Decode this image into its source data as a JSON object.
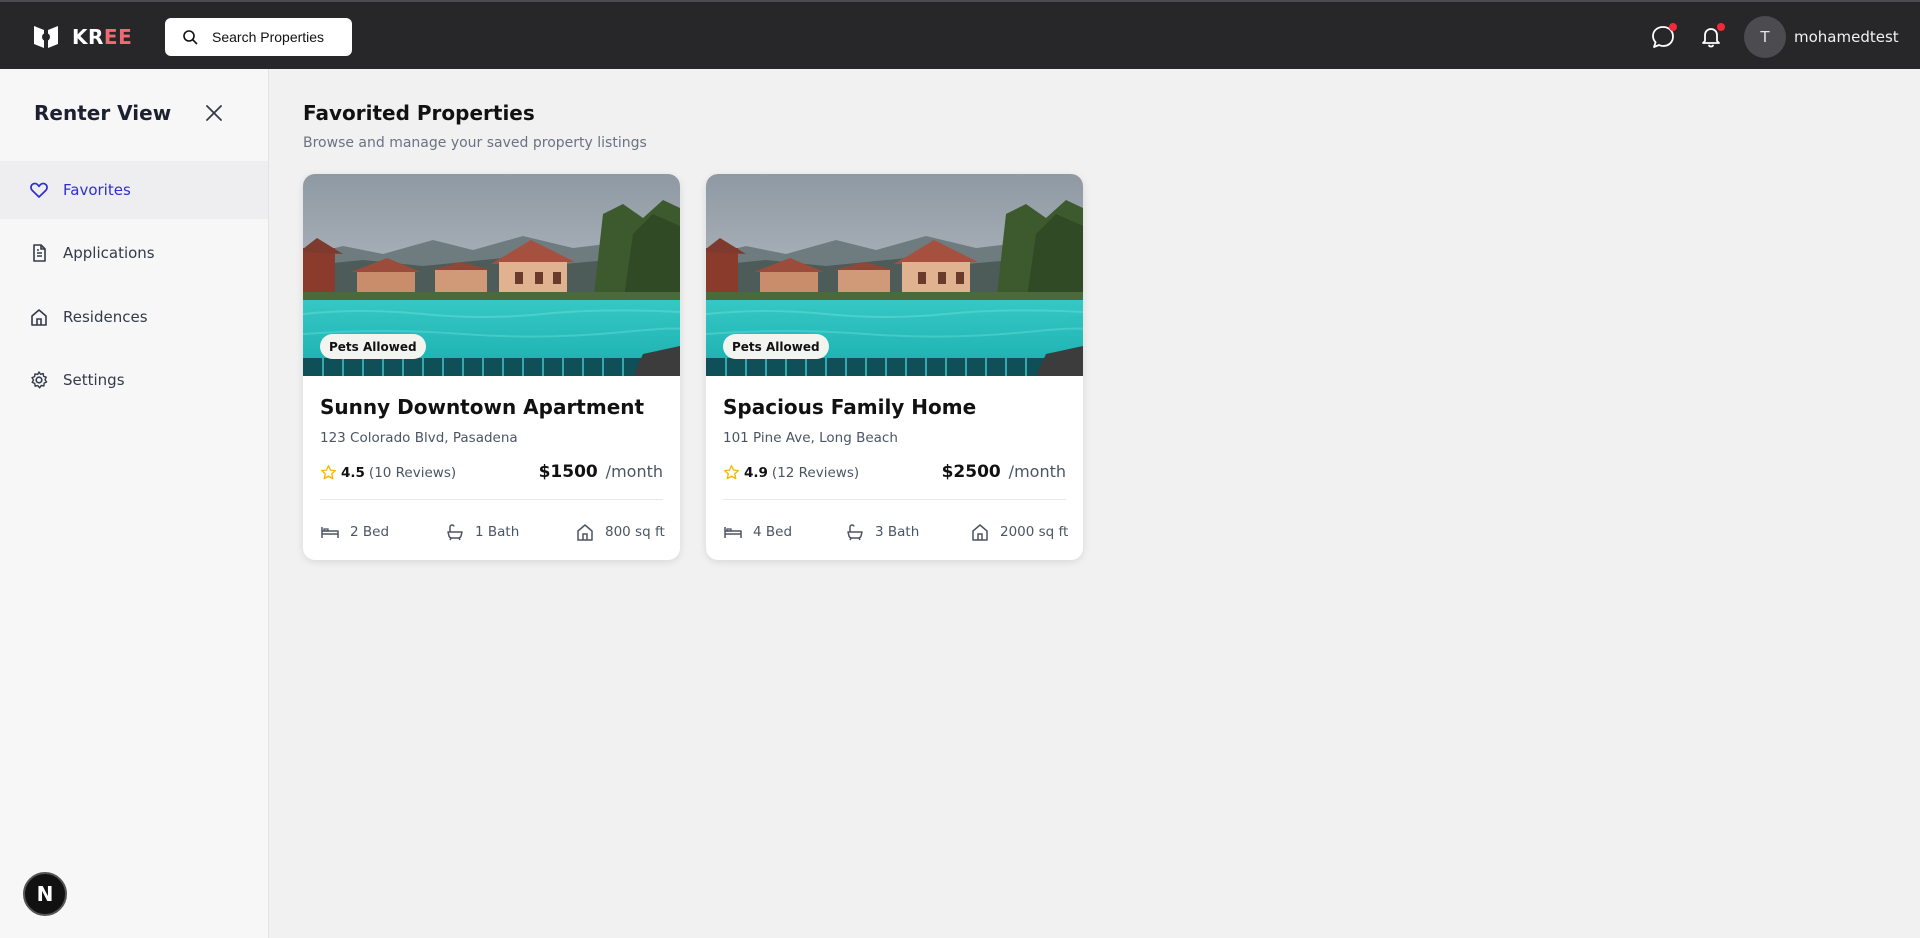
{
  "app": {
    "brand_primary": "KR",
    "brand_accent": "EE",
    "search_label": "Search Properties",
    "username": "mohamedtest",
    "avatar_initial": "T",
    "colors": {
      "topbar": "#27272a",
      "accent": "#ef6b73",
      "active_nav": "#2d2fd0",
      "notification_dot": "#ef2b3a",
      "star": "#f5b800"
    }
  },
  "header_icons": [
    "chat-icon",
    "bell-icon"
  ],
  "sidebar": {
    "title": "Renter View",
    "items": [
      {
        "label": "Favorites",
        "icon": "heart-icon",
        "active": true
      },
      {
        "label": "Applications",
        "icon": "document-icon",
        "active": false
      },
      {
        "label": "Residences",
        "icon": "house-icon",
        "active": false
      },
      {
        "label": "Settings",
        "icon": "gear-icon",
        "active": false
      }
    ],
    "badge": "N"
  },
  "main": {
    "title": "Favorited Properties",
    "subtitle": "Browse and manage your saved property listings"
  },
  "properties": [
    {
      "badge": "Pets Allowed",
      "name": "Sunny Downtown Apartment",
      "address": "123 Colorado Blvd, Pasadena",
      "rating": "4.5",
      "reviews": "(10 Reviews)",
      "price": "$1500",
      "price_unit": "/month",
      "beds": "2 Bed",
      "baths": "1 Bath",
      "area": "800 sq ft"
    },
    {
      "badge": "Pets Allowed",
      "name": "Spacious Family Home",
      "address": "101 Pine Ave, Long Beach",
      "rating": "4.9",
      "reviews": "(12 Reviews)",
      "price": "$2500",
      "price_unit": "/month",
      "beds": "4 Bed",
      "baths": "3 Bath",
      "area": "2000 sq ft"
    }
  ]
}
